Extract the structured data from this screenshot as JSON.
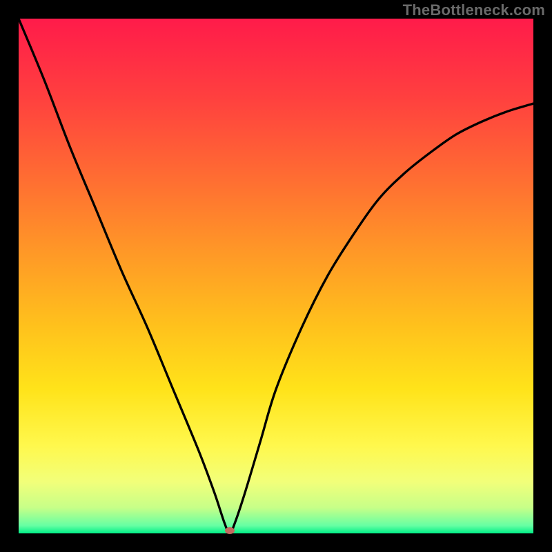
{
  "watermark": "TheBottleneck.com",
  "chart_data": {
    "type": "line",
    "title": "",
    "xlabel": "",
    "ylabel": "",
    "xlim": [
      0,
      100
    ],
    "ylim": [
      0,
      100
    ],
    "grid": false,
    "notes": "Background is a vertical gradient from red (top, high bottleneck) through orange/yellow to green (bottom, no bottleneck). The black curve forms a V shape with minimum near x≈41 at y≈0, indicating the optimal match point. Reddish marker sits at the curve minimum.",
    "marker": {
      "x": 41,
      "y": 0.5
    },
    "gradient_stops": [
      {
        "pos": 0.0,
        "color": "#ff1b4a"
      },
      {
        "pos": 0.15,
        "color": "#ff3f3f"
      },
      {
        "pos": 0.3,
        "color": "#ff6a33"
      },
      {
        "pos": 0.45,
        "color": "#ff9727"
      },
      {
        "pos": 0.6,
        "color": "#ffc21c"
      },
      {
        "pos": 0.72,
        "color": "#ffe31a"
      },
      {
        "pos": 0.83,
        "color": "#fff84d"
      },
      {
        "pos": 0.9,
        "color": "#f2ff7a"
      },
      {
        "pos": 0.95,
        "color": "#c7ff88"
      },
      {
        "pos": 0.985,
        "color": "#66ffa3"
      },
      {
        "pos": 1.0,
        "color": "#00ef87"
      }
    ],
    "series": [
      {
        "name": "bottleneck-curve",
        "x": [
          0,
          5,
          10,
          15,
          20,
          25,
          30,
          35,
          38,
          40,
          41,
          42,
          44,
          47,
          50,
          55,
          60,
          65,
          70,
          75,
          80,
          85,
          90,
          95,
          100
        ],
        "y": [
          100,
          88,
          75,
          63,
          51,
          40,
          28,
          16,
          8,
          2,
          0,
          2,
          8,
          18,
          28,
          40,
          50,
          58,
          65,
          70,
          74,
          77.5,
          80,
          82,
          83.5
        ]
      }
    ]
  }
}
